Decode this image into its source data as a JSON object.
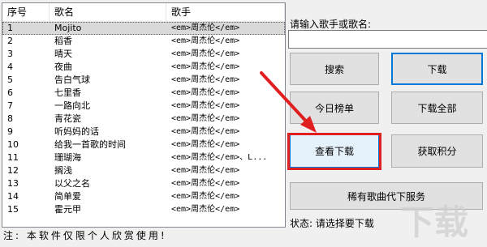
{
  "list": {
    "columns": [
      "序号",
      "歌名",
      "歌手"
    ],
    "rows": [
      {
        "no": "1",
        "name": "Mojito",
        "singer": "<em>周杰伦</em>"
      },
      {
        "no": "2",
        "name": "稻香",
        "singer": "<em>周杰伦</em>"
      },
      {
        "no": "3",
        "name": "晴天",
        "singer": "<em>周杰伦</em>"
      },
      {
        "no": "4",
        "name": "夜曲",
        "singer": "<em>周杰伦</em>"
      },
      {
        "no": "5",
        "name": "告白气球",
        "singer": "<em>周杰伦</em>"
      },
      {
        "no": "6",
        "name": "七里香",
        "singer": "<em>周杰伦</em>"
      },
      {
        "no": "7",
        "name": "一路向北",
        "singer": "<em>周杰伦</em>"
      },
      {
        "no": "8",
        "name": "青花瓷",
        "singer": "<em>周杰伦</em>"
      },
      {
        "no": "9",
        "name": "听妈妈的话",
        "singer": "<em>周杰伦</em>"
      },
      {
        "no": "10",
        "name": "给我一首歌的时间",
        "singer": "<em>周杰伦</em>"
      },
      {
        "no": "11",
        "name": "珊瑚海",
        "singer": "<em>周杰伦</em>、L..."
      },
      {
        "no": "12",
        "name": "搁浅",
        "singer": "<em>周杰伦</em>"
      },
      {
        "no": "13",
        "name": "以父之名",
        "singer": "<em>周杰伦</em>"
      },
      {
        "no": "14",
        "name": "简单爱",
        "singer": "<em>周杰伦</em>"
      },
      {
        "no": "15",
        "name": "霍元甲",
        "singer": "<em>周杰伦</em>"
      }
    ]
  },
  "note": "注: 本软件仅限个人欣赏使用!",
  "search": {
    "label": "请输入歌手或歌名:",
    "value": ""
  },
  "buttons": {
    "search": "搜索",
    "download": "下载",
    "today_chart": "今日榜单",
    "download_all": "下载全部",
    "view_downloads": "查看下载",
    "get_points": "获取积分",
    "rare_service": "稀有歌曲代下服务"
  },
  "status": "状态: 请选择要下载",
  "watermark": "下载"
}
